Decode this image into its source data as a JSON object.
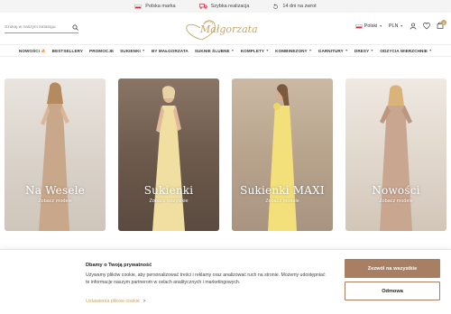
{
  "topbar": {
    "items": [
      {
        "icon": "flag-pl-icon",
        "label": "Polska marka"
      },
      {
        "icon": "truck-icon",
        "label": "Szybka realizacja"
      },
      {
        "icon": "return-icon",
        "label": "14 dni na zwrot"
      }
    ]
  },
  "header": {
    "search_placeholder": "Szukaj w naszym katalogu",
    "logo_text": "Małgorzata",
    "language": "Polski",
    "currency": "PLN",
    "cart_count": "0"
  },
  "nav": {
    "items": [
      {
        "label": "NOWOŚCI",
        "new": "🔥"
      },
      {
        "label": "BESTSELLERY"
      },
      {
        "label": "PROMOCJE"
      },
      {
        "label": "SUKIENKI"
      },
      {
        "label": "BY MAŁGORZATA"
      },
      {
        "label": "SUKNIE ŚLUBNE"
      },
      {
        "label": "KOMPLETY"
      },
      {
        "label": "KOMBINEZONY"
      },
      {
        "label": "GARNITURY"
      },
      {
        "label": "DRESY"
      },
      {
        "label": "ODZYCIA WIERZCHNIE"
      }
    ]
  },
  "categories": [
    {
      "title": "Na Wesele",
      "subtitle": "Zobacz modele",
      "color": "#c9a78a"
    },
    {
      "title": "Sukienki",
      "subtitle": "Zobacz wszystkie",
      "color": "#f0dfa0"
    },
    {
      "title": "Sukienki MAXI",
      "subtitle": "Zobacz modele",
      "color": "#f3e07a"
    },
    {
      "title": "Nowości",
      "subtitle": "Zobacz modele",
      "color": "#c9a690"
    }
  ],
  "cookie": {
    "title": "Dbamy o Twoją prywatność",
    "text": "Używamy plików cookie, aby personalizować treści i reklamy oraz analizować ruch na stronie. Możemy udostępniać te informacje naszym partnerom w celach analitycznych i marketingowych.",
    "settings_link": "Ustawienia plików cookie",
    "accept_label": "Zezwól na wszystkie",
    "reject_label": "Odmowa"
  },
  "colors": {
    "brand_gold": "#c8a467",
    "accept_brown": "#a97f63"
  }
}
